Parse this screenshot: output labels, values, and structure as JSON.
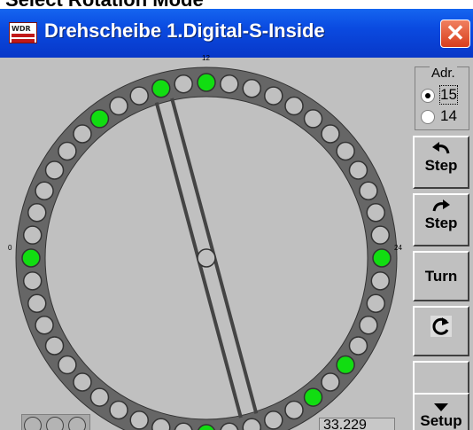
{
  "header_text": "Select Rotation Mode",
  "window": {
    "title": "Drehscheibe 1.Digital-S-Inside",
    "icon_text": "WDR",
    "close_glyph": "✕"
  },
  "turntable": {
    "track_count": 48,
    "active_tracks": [
      0,
      7,
      10,
      12,
      24,
      29,
      31,
      36
    ],
    "rotation_track": 10,
    "labels": {
      "top": "12",
      "left": "0",
      "right": "24"
    },
    "colors": {
      "active": "#11dd11",
      "inactive": "#c0c0c0",
      "ring": "#666666",
      "bridge": "#444444"
    }
  },
  "address": {
    "title": "Adr.",
    "options": [
      {
        "label": "15",
        "selected": true
      },
      {
        "label": "14",
        "selected": false
      }
    ]
  },
  "buttons": {
    "step_ccw": "Step",
    "step_cw": "Step",
    "turn": "Turn",
    "refresh_icon": "refresh-icon",
    "setup": "Setup"
  },
  "readout": "33.229"
}
